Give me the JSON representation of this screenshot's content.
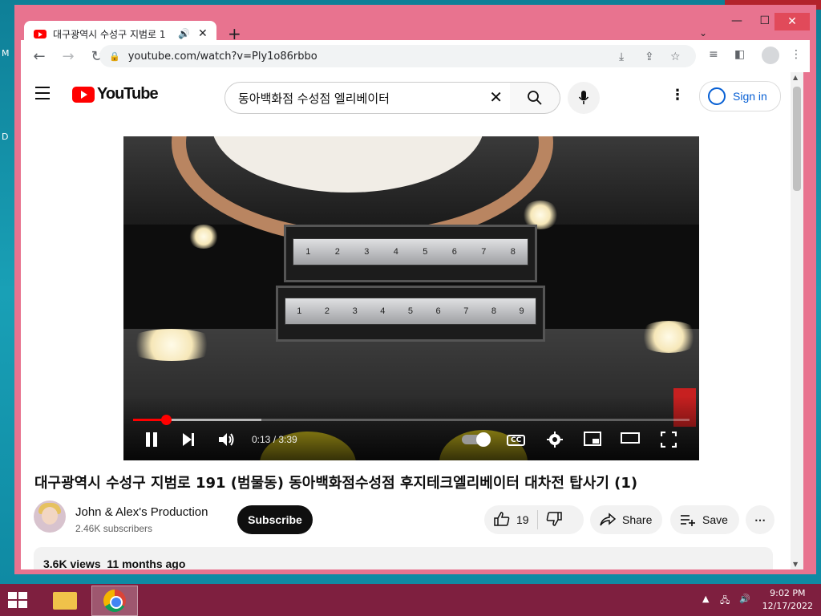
{
  "desktop": {
    "edge_letters": [
      "M",
      "D"
    ]
  },
  "browser": {
    "tab": {
      "title": "대구광역시 수성구 지범로 1",
      "close": "✕",
      "audio": "🔊"
    },
    "new_tab": "+",
    "window_controls": {
      "minimize": "—",
      "maximize": "☐",
      "close": "✕"
    },
    "nav": {
      "back": "←",
      "forward": "→",
      "reload": "↻"
    },
    "url": "youtube.com/watch?v=Ply1o86rbbo"
  },
  "youtube": {
    "logo_text": "YouTube",
    "search": {
      "query": "동아백화점 수성점 엘리베이터",
      "clear": "✕"
    },
    "sign_in": "Sign in",
    "player": {
      "current_time": "0:13",
      "duration": "3:39",
      "time_display": "0:13 / 3:39",
      "progress": 0.059,
      "buffered": 0.23,
      "cc_label": "CC",
      "panel_numbers_top": [
        "1",
        "2",
        "3",
        "4",
        "5",
        "6",
        "7",
        "8"
      ],
      "panel_numbers_bottom": [
        "1",
        "2",
        "3",
        "4",
        "5",
        "6",
        "7",
        "8",
        "9"
      ]
    },
    "video": {
      "title": "대구광역시 수성구 지범로 191 (범물동) 동아백화점수성점 후지테크엘리베이터 대차전 탑사기 (1)",
      "channel_name": "John & Alex's Production",
      "subscribers": "2.46K subscribers",
      "subscribe_label": "Subscribe",
      "likes": "19",
      "share_label": "Share",
      "save_label": "Save",
      "views": "3.6K views",
      "age": "11 months ago"
    }
  },
  "taskbar": {
    "time": "9:02 PM",
    "date": "12/17/2022"
  },
  "colors": {
    "accent": "#ff0000",
    "link": "#065fd4",
    "window_frame": "#e8738f",
    "taskbar": "#7e1f3f"
  }
}
